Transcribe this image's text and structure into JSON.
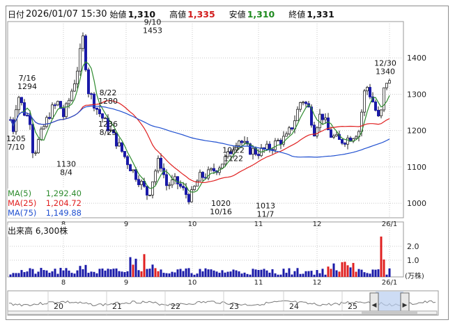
{
  "header": {
    "date_label": "日付",
    "date_value": "2026/01/07 15:30",
    "open_label": "始値",
    "open_value": "1,310",
    "high_label": "高値",
    "high_value": "1,335",
    "low_label": "安値",
    "low_value": "1,310",
    "close_label": "終値",
    "close_value": "1,331"
  },
  "colors": {
    "up": "#1a1aa8",
    "ma5": "#2e8b2e",
    "ma25": "#e02020",
    "ma75": "#2050d0",
    "volume": "#1a1aa8",
    "volume_hl": "#e02020",
    "grid": "#c8c8c8"
  },
  "ma_legend": [
    {
      "name": "MA(5)",
      "value": "1,292.40",
      "color": "#2e8b2e"
    },
    {
      "name": "MA(25)",
      "value": "1,204.72",
      "color": "#e02020"
    },
    {
      "name": "MA(75)",
      "value": "1,149.88",
      "color": "#2050d0"
    }
  ],
  "price_axis": {
    "ticks": [
      "1400",
      "1300",
      "1200",
      "1100",
      "1000"
    ],
    "values": [
      1400,
      1300,
      1200,
      1100,
      1000
    ],
    "min": 960,
    "max": 1500
  },
  "month_ticks": [
    "8",
    "9",
    "10",
    "11",
    "12",
    "26/1"
  ],
  "annotations": [
    {
      "date": "7/16",
      "price": "1294"
    },
    {
      "date": "7/10",
      "price": "1205"
    },
    {
      "date": "8/4",
      "price": "1130"
    },
    {
      "date": "8/22",
      "price": "1280"
    },
    {
      "date": "8/25",
      "price": "1236"
    },
    {
      "date": "9/10",
      "price": "1453"
    },
    {
      "date": "10/22",
      "price": "1122"
    },
    {
      "date": "10/16",
      "price": "1020"
    },
    {
      "date": "11/7",
      "price": "1013"
    },
    {
      "date": "12/30",
      "price": "1340"
    }
  ],
  "volume": {
    "title": "出来高",
    "value": "6,300株",
    "ticks": [
      "2.0",
      "1.0"
    ],
    "unit": "(万株)"
  },
  "navigator": {
    "labels": [
      "20",
      "21",
      "22",
      "23",
      "24",
      "25"
    ],
    "left_arrow": "◀",
    "right_arrow": "▶"
  },
  "chart_data": {
    "type": "candlestick",
    "title": "",
    "price_range": [
      960,
      1500
    ],
    "series": [
      {
        "name": "MA(5)",
        "value": 1292.4
      },
      {
        "name": "MA(25)",
        "value": 1204.72
      },
      {
        "name": "MA(75)",
        "value": 1149.88
      }
    ],
    "last": {
      "date": "2026/01/07",
      "open": 1310,
      "high": 1335,
      "low": 1310,
      "close": 1331
    },
    "extremes": [
      {
        "date": "7/10",
        "price": 1205
      },
      {
        "date": "7/16",
        "price": 1294
      },
      {
        "date": "8/4",
        "price": 1130
      },
      {
        "date": "8/22",
        "price": 1280
      },
      {
        "date": "8/25",
        "price": 1236
      },
      {
        "date": "9/10",
        "price": 1453
      },
      {
        "date": "10/16",
        "price": 1020
      },
      {
        "date": "10/22",
        "price": 1122
      },
      {
        "date": "11/7",
        "price": 1013
      },
      {
        "date": "12/30",
        "price": 1340
      }
    ]
  }
}
